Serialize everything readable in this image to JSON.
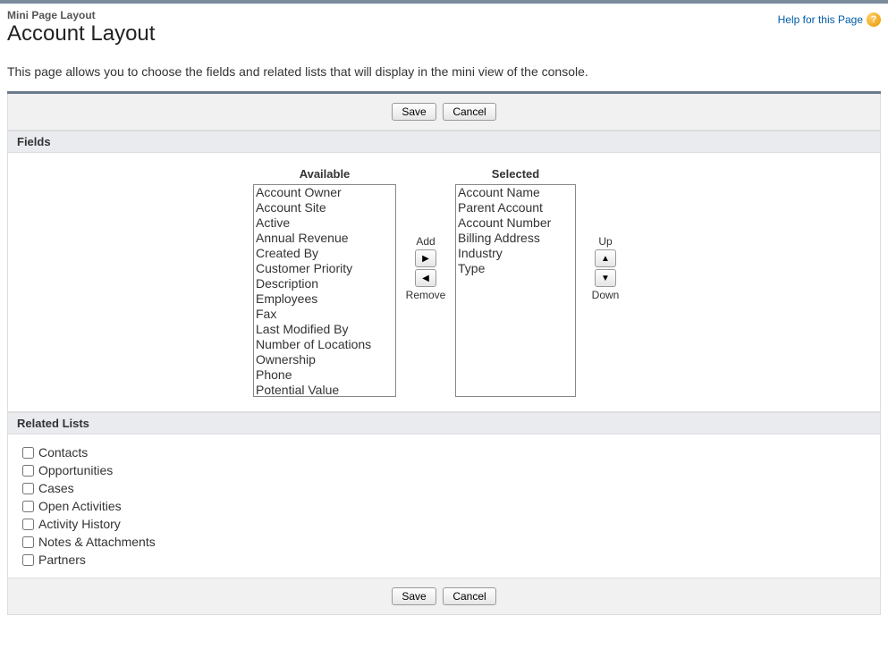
{
  "header": {
    "breadcrumb": "Mini Page Layout",
    "title": "Account Layout",
    "help_label": "Help for this Page",
    "help_icon_glyph": "?"
  },
  "description": "This page allows you to choose the fields and related lists that will display in the mini view of the console.",
  "buttons": {
    "save": "Save",
    "cancel": "Cancel"
  },
  "sections": {
    "fields_title": "Fields",
    "related_lists_title": "Related Lists"
  },
  "dual_list": {
    "available_label": "Available",
    "selected_label": "Selected",
    "add_label": "Add",
    "remove_label": "Remove",
    "up_label": "Up",
    "down_label": "Down",
    "available": [
      "Account Owner",
      "Account Site",
      "Active",
      "Annual Revenue",
      "Created By",
      "Customer Priority",
      "Description",
      "Employees",
      "Fax",
      "Last Modified By",
      "Number of Locations",
      "Ownership",
      "Phone",
      "Potential Value"
    ],
    "selected": [
      "Account Name",
      "Parent Account",
      "Account Number",
      "Billing Address",
      "Industry",
      "Type"
    ]
  },
  "related_lists": [
    "Contacts",
    "Opportunities",
    "Cases",
    "Open Activities",
    "Activity History",
    "Notes & Attachments",
    "Partners"
  ]
}
